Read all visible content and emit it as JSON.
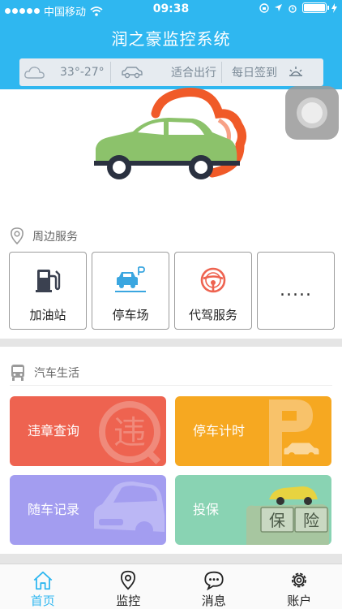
{
  "status_bar": {
    "carrier": "中国移动",
    "time": "09:38"
  },
  "header": {
    "title": "润之豪监控系统"
  },
  "info_bar": {
    "temperature": "33°-27°",
    "travel": "适合出行",
    "checkin": "每日签到"
  },
  "nearby": {
    "heading": "周边服务",
    "items": [
      {
        "label": "加油站",
        "icon": "gas-pump-icon"
      },
      {
        "label": "停车场",
        "icon": "parking-icon"
      },
      {
        "label": "代驾服务",
        "icon": "steering-wheel-icon"
      },
      {
        "label": "....."
      }
    ]
  },
  "car_life": {
    "heading": "汽车生活",
    "cards": [
      {
        "label": "违章查询",
        "color": "#ee6350"
      },
      {
        "label": "停车计时",
        "color": "#f6a821"
      },
      {
        "label": "随车记录",
        "color": "#a39df0"
      },
      {
        "label": "投保",
        "color": "#89d3b3"
      }
    ],
    "card_marks": {
      "violation": "违",
      "insurance_a": "保",
      "insurance_b": "险"
    }
  },
  "tabbar": {
    "tabs": [
      {
        "label": "首页",
        "icon": "home-icon",
        "active": true
      },
      {
        "label": "监控",
        "icon": "location-pin-icon"
      },
      {
        "label": "消息",
        "icon": "chat-bubble-icon"
      },
      {
        "label": "账户",
        "icon": "gear-icon"
      }
    ]
  },
  "colors": {
    "accent": "#2fb7f0",
    "car_green": "#8cc26b",
    "logo_orange": "#f05a28"
  }
}
